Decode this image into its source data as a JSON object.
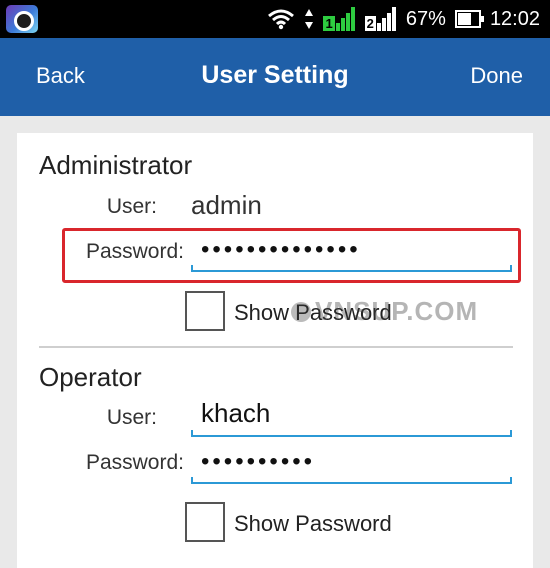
{
  "status_bar": {
    "sim1_label": "1",
    "sim2_label": "2",
    "battery_percent_text": "67%",
    "battery_level": 0.67,
    "time": "12:02"
  },
  "app_bar": {
    "back_label": "Back",
    "title": "User Setting",
    "done_label": "Done",
    "color": "#1f5fa8"
  },
  "administrator": {
    "heading": "Administrator",
    "user_label": "User:",
    "user_value": "admin",
    "password_label": "Password:",
    "password_value": "••••••••••••••",
    "show_password_label": "Show Password",
    "show_password_checked": false
  },
  "operator": {
    "heading": "Operator",
    "user_label": "User:",
    "user_value": "khach",
    "password_label": "Password:",
    "password_value": "••••••••••",
    "show_password_label": "Show Password",
    "show_password_checked": false
  },
  "watermark": "VNSUP.COM",
  "colors": {
    "accent_underline": "#2b99d6",
    "highlight_border": "#d9262c"
  }
}
